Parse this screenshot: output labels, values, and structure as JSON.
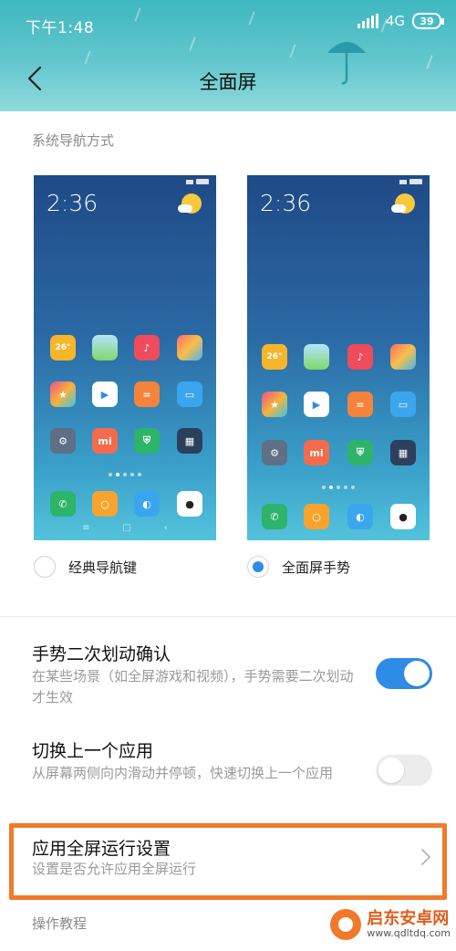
{
  "status_bar": {
    "time": "下午1:48",
    "network": "4G",
    "battery": "39"
  },
  "header": {
    "title": "全面屏",
    "back_icon": "chevron-left-icon"
  },
  "nav_section": {
    "label": "系统导航方式",
    "options": [
      {
        "label": "经典导航键",
        "selected": false
      },
      {
        "label": "全面屏手势",
        "selected": true
      }
    ],
    "preview_clock": "2:36",
    "preview_temp": "26°"
  },
  "settings": [
    {
      "title": "手势二次划动确认",
      "description": "在某些场景（如全屏游戏和视频），手势需要二次划动才生效",
      "toggle": true
    },
    {
      "title": "切换上一个应用",
      "description": "从屏幕两侧向内滑动并停顿，快速切换上一个应用",
      "toggle": false
    },
    {
      "title": "应用全屏运行设置",
      "description": "设置是否允许应用全屏运行",
      "chevron": true
    }
  ],
  "tutorial_section": {
    "label": "操作教程"
  },
  "watermark": {
    "name": "启东安卓网",
    "url": "www.qdltdq.com"
  },
  "colors": {
    "accent": "#2f8ce6",
    "header_teal": "#4fbec5",
    "highlight": "#f07a2a"
  }
}
